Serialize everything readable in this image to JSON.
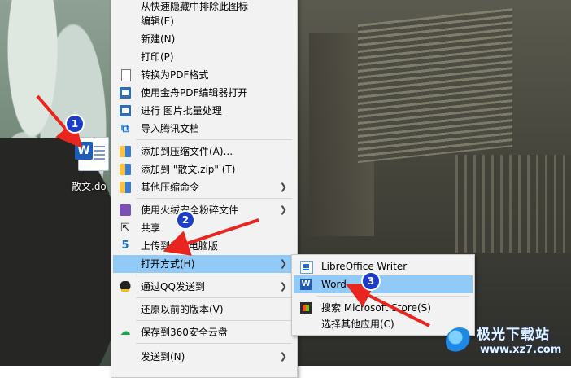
{
  "desktop": {
    "file_label": "散文.do",
    "file_icon_letter": "W"
  },
  "context_menu": {
    "items": [
      {
        "label": "从快速隐藏中排除此图标",
        "icon": "none"
      },
      {
        "label": "编辑(E)",
        "icon": "none"
      },
      {
        "label": "新建(N)",
        "icon": "none"
      },
      {
        "label": "打印(P)",
        "icon": "none"
      },
      {
        "label": "转换为PDF格式",
        "icon": "pdf-page-icon"
      },
      {
        "label": "使用金舟PDF编辑器打开",
        "icon": "pdf-editor-icon"
      },
      {
        "label": "进行 图片批量处理",
        "icon": "image-batch-icon"
      },
      {
        "label": "导入腾讯文档",
        "icon": "tencent-docs-icon"
      },
      {
        "label": "添加到压缩文件(A)...",
        "icon": "archive-icon"
      },
      {
        "label": "添加到 \"散文.zip\" (T)",
        "icon": "archive-icon"
      },
      {
        "label": "其他压缩命令",
        "icon": "archive-icon",
        "submenu": true
      },
      {
        "label": "使用火绒安全粉碎文件",
        "icon": "shredder-icon",
        "submenu": true
      },
      {
        "label": "共享",
        "icon": "share-icon"
      },
      {
        "label": "上传到115电脑版",
        "icon": "cloud-115-icon"
      },
      {
        "label": "打开方式(H)",
        "icon": "none",
        "submenu": true,
        "highlighted": true
      },
      {
        "label": "通过QQ发送到",
        "icon": "qq-icon",
        "submenu": true
      },
      {
        "label": "还原以前的版本(V)",
        "icon": "none"
      },
      {
        "label": "保存到360安全云盘",
        "icon": "cloud-360-icon"
      },
      {
        "label": "发送到(N)",
        "icon": "none",
        "submenu": true
      }
    ]
  },
  "open_with_submenu": {
    "items": [
      {
        "label": "LibreOffice Writer",
        "icon": "libreoffice-writer-icon"
      },
      {
        "label": "Word",
        "icon": "word-icon",
        "highlighted": true
      },
      {
        "label": "搜索 Microsoft Store(S)",
        "icon": "microsoft-store-icon"
      },
      {
        "label": "选择其他应用(C)",
        "icon": "none"
      }
    ]
  },
  "annotations": {
    "badges": [
      "1",
      "2",
      "3"
    ],
    "arrow_color": "#e8251f"
  },
  "watermark": {
    "brand": "极光下载站",
    "url": "www.xz7.com"
  },
  "colors": {
    "menu_bg": "#f2f2f2",
    "highlight": "#91c9f7",
    "badge": "#1b3dc8"
  }
}
